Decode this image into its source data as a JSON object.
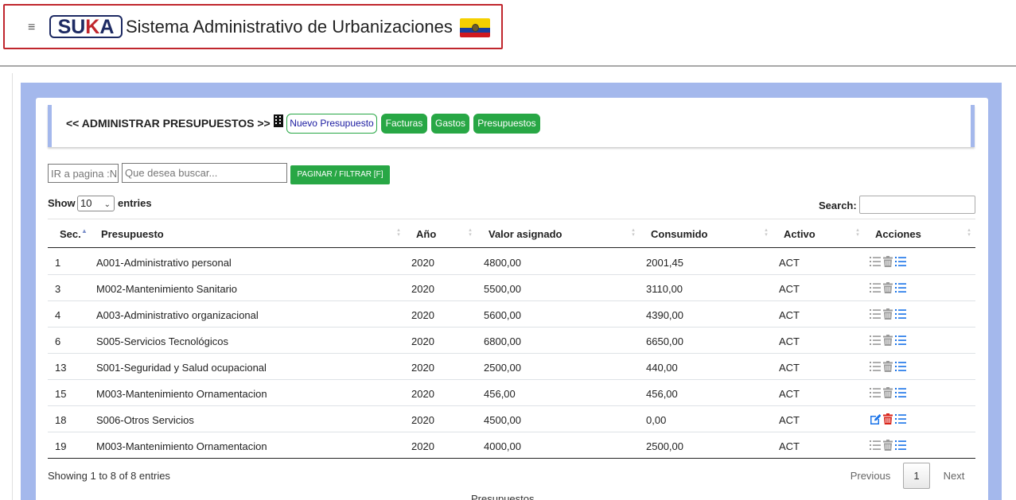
{
  "app": {
    "logo_su": "SU",
    "logo_k": "K",
    "logo_a": "A",
    "title": "Sistema Administrativo de Urbanizaciones"
  },
  "header": {
    "title": "<< ADMINISTRAR PRESUPUESTOS >>",
    "buttons": {
      "nuevo": "Nuevo Presupuesto",
      "facturas": "Facturas",
      "gastos": "Gastos",
      "presupuestos": "Presupuestos"
    }
  },
  "filters": {
    "page_placeholder": "IR a pagina :N",
    "search_placeholder": "Que desea buscar...",
    "paginate_label": "PAGINAR / FILTRAR [F]"
  },
  "table_controls": {
    "show_label": "Show",
    "page_size": "10",
    "entries_label": "entries",
    "search_label": "Search:"
  },
  "table": {
    "columns": [
      "Sec.",
      "Presupuesto",
      "Año",
      "Valor asignado",
      "Consumido",
      "Activo",
      "Acciones"
    ],
    "rows": [
      {
        "sec": "1",
        "presupuesto": "A001-Administrativo personal",
        "anio": "2020",
        "valor": "4800,00",
        "consumido": "2001,45",
        "activo": "ACT",
        "editable": false
      },
      {
        "sec": "3",
        "presupuesto": "M002-Mantenimiento Sanitario",
        "anio": "2020",
        "valor": "5500,00",
        "consumido": "3110,00",
        "activo": "ACT",
        "editable": false
      },
      {
        "sec": "4",
        "presupuesto": "A003-Administrativo organizacional",
        "anio": "2020",
        "valor": "5600,00",
        "consumido": "4390,00",
        "activo": "ACT",
        "editable": false
      },
      {
        "sec": "6",
        "presupuesto": "S005-Servicios Tecnológicos",
        "anio": "2020",
        "valor": "6800,00",
        "consumido": "6650,00",
        "activo": "ACT",
        "editable": false
      },
      {
        "sec": "13",
        "presupuesto": "S001-Seguridad y Salud ocupacional",
        "anio": "2020",
        "valor": "2500,00",
        "consumido": "440,00",
        "activo": "ACT",
        "editable": false
      },
      {
        "sec": "15",
        "presupuesto": "M003-Mantenimiento Ornamentacion",
        "anio": "2020",
        "valor": "456,00",
        "consumido": "456,00",
        "activo": "ACT",
        "editable": false
      },
      {
        "sec": "18",
        "presupuesto": "S006-Otros Servicios",
        "anio": "2020",
        "valor": "4500,00",
        "consumido": "0,00",
        "activo": "ACT",
        "editable": true
      },
      {
        "sec": "19",
        "presupuesto": "M003-Mantenimiento Ornamentacion",
        "anio": "2020",
        "valor": "4000,00",
        "consumido": "2500,00",
        "activo": "ACT",
        "editable": false
      }
    ]
  },
  "footer": {
    "info": "Showing 1 to 8 of 8 entries",
    "previous": "Previous",
    "page": "1",
    "next": "Next",
    "caption": "Presupuestos"
  },
  "icons": {
    "menu": "hamburger-icon",
    "flag": "ecuador-flag-icon",
    "building": "building-icon",
    "edit": "edit-icon",
    "delete": "trash-icon",
    "list": "list-icon"
  },
  "colors": {
    "brand_red": "#c0262d",
    "brand_navy": "#1d2a63",
    "frame_blue": "#a4b8ec",
    "success_green": "#28a745",
    "icon_blue": "#1a73e8",
    "icon_gray": "#9a9a9a",
    "icon_red": "#d9261c"
  }
}
